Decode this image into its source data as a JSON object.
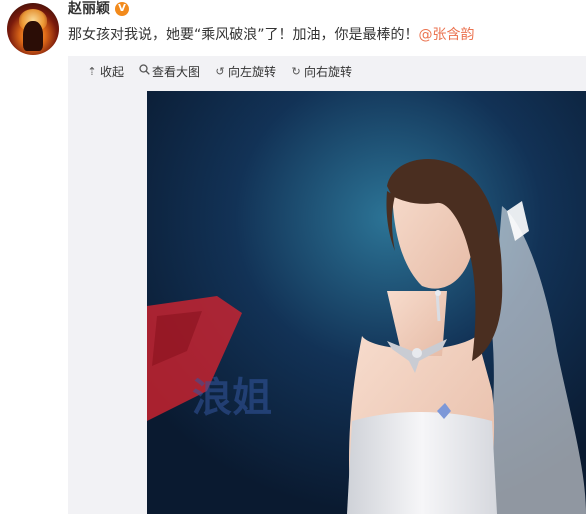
{
  "post": {
    "author": "赵丽颖",
    "vip_badge": "V",
    "text_before_mention": "那女孩对我说，她要“乘风破浪”了！加油，你是最棒的！",
    "mention": "@张含韵"
  },
  "media_toolbar": {
    "collapse_label": "收起",
    "view_large_label": "查看大图",
    "rotate_left_label": "向左旋转",
    "rotate_right_label": "向右旋转"
  },
  "photo": {
    "background_text": "浪姐"
  },
  "colors": {
    "mention": "#eb7350",
    "vip_badge": "#f28a1c",
    "media_background": "#f2f2f5",
    "photo_background": "#0e2440",
    "stage_logo_red": "#d9232f"
  }
}
